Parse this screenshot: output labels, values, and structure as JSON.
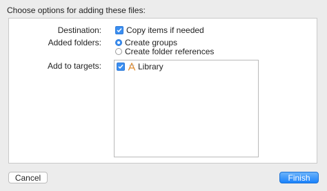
{
  "dialog": {
    "header": "Choose options for adding these files:"
  },
  "destination": {
    "label": "Destination:",
    "option": "Copy items if needed",
    "checked": true
  },
  "added_folders": {
    "label": "Added folders:",
    "options": [
      {
        "label": "Create groups",
        "selected": true
      },
      {
        "label": "Create folder references",
        "selected": false
      }
    ]
  },
  "targets": {
    "label": "Add to targets:",
    "items": [
      {
        "label": "Library",
        "checked": true,
        "icon": "app-target-icon"
      }
    ]
  },
  "buttons": {
    "cancel": "Cancel",
    "finish": "Finish"
  },
  "colors": {
    "accent": "#3b8ef0",
    "background": "#ececec"
  }
}
